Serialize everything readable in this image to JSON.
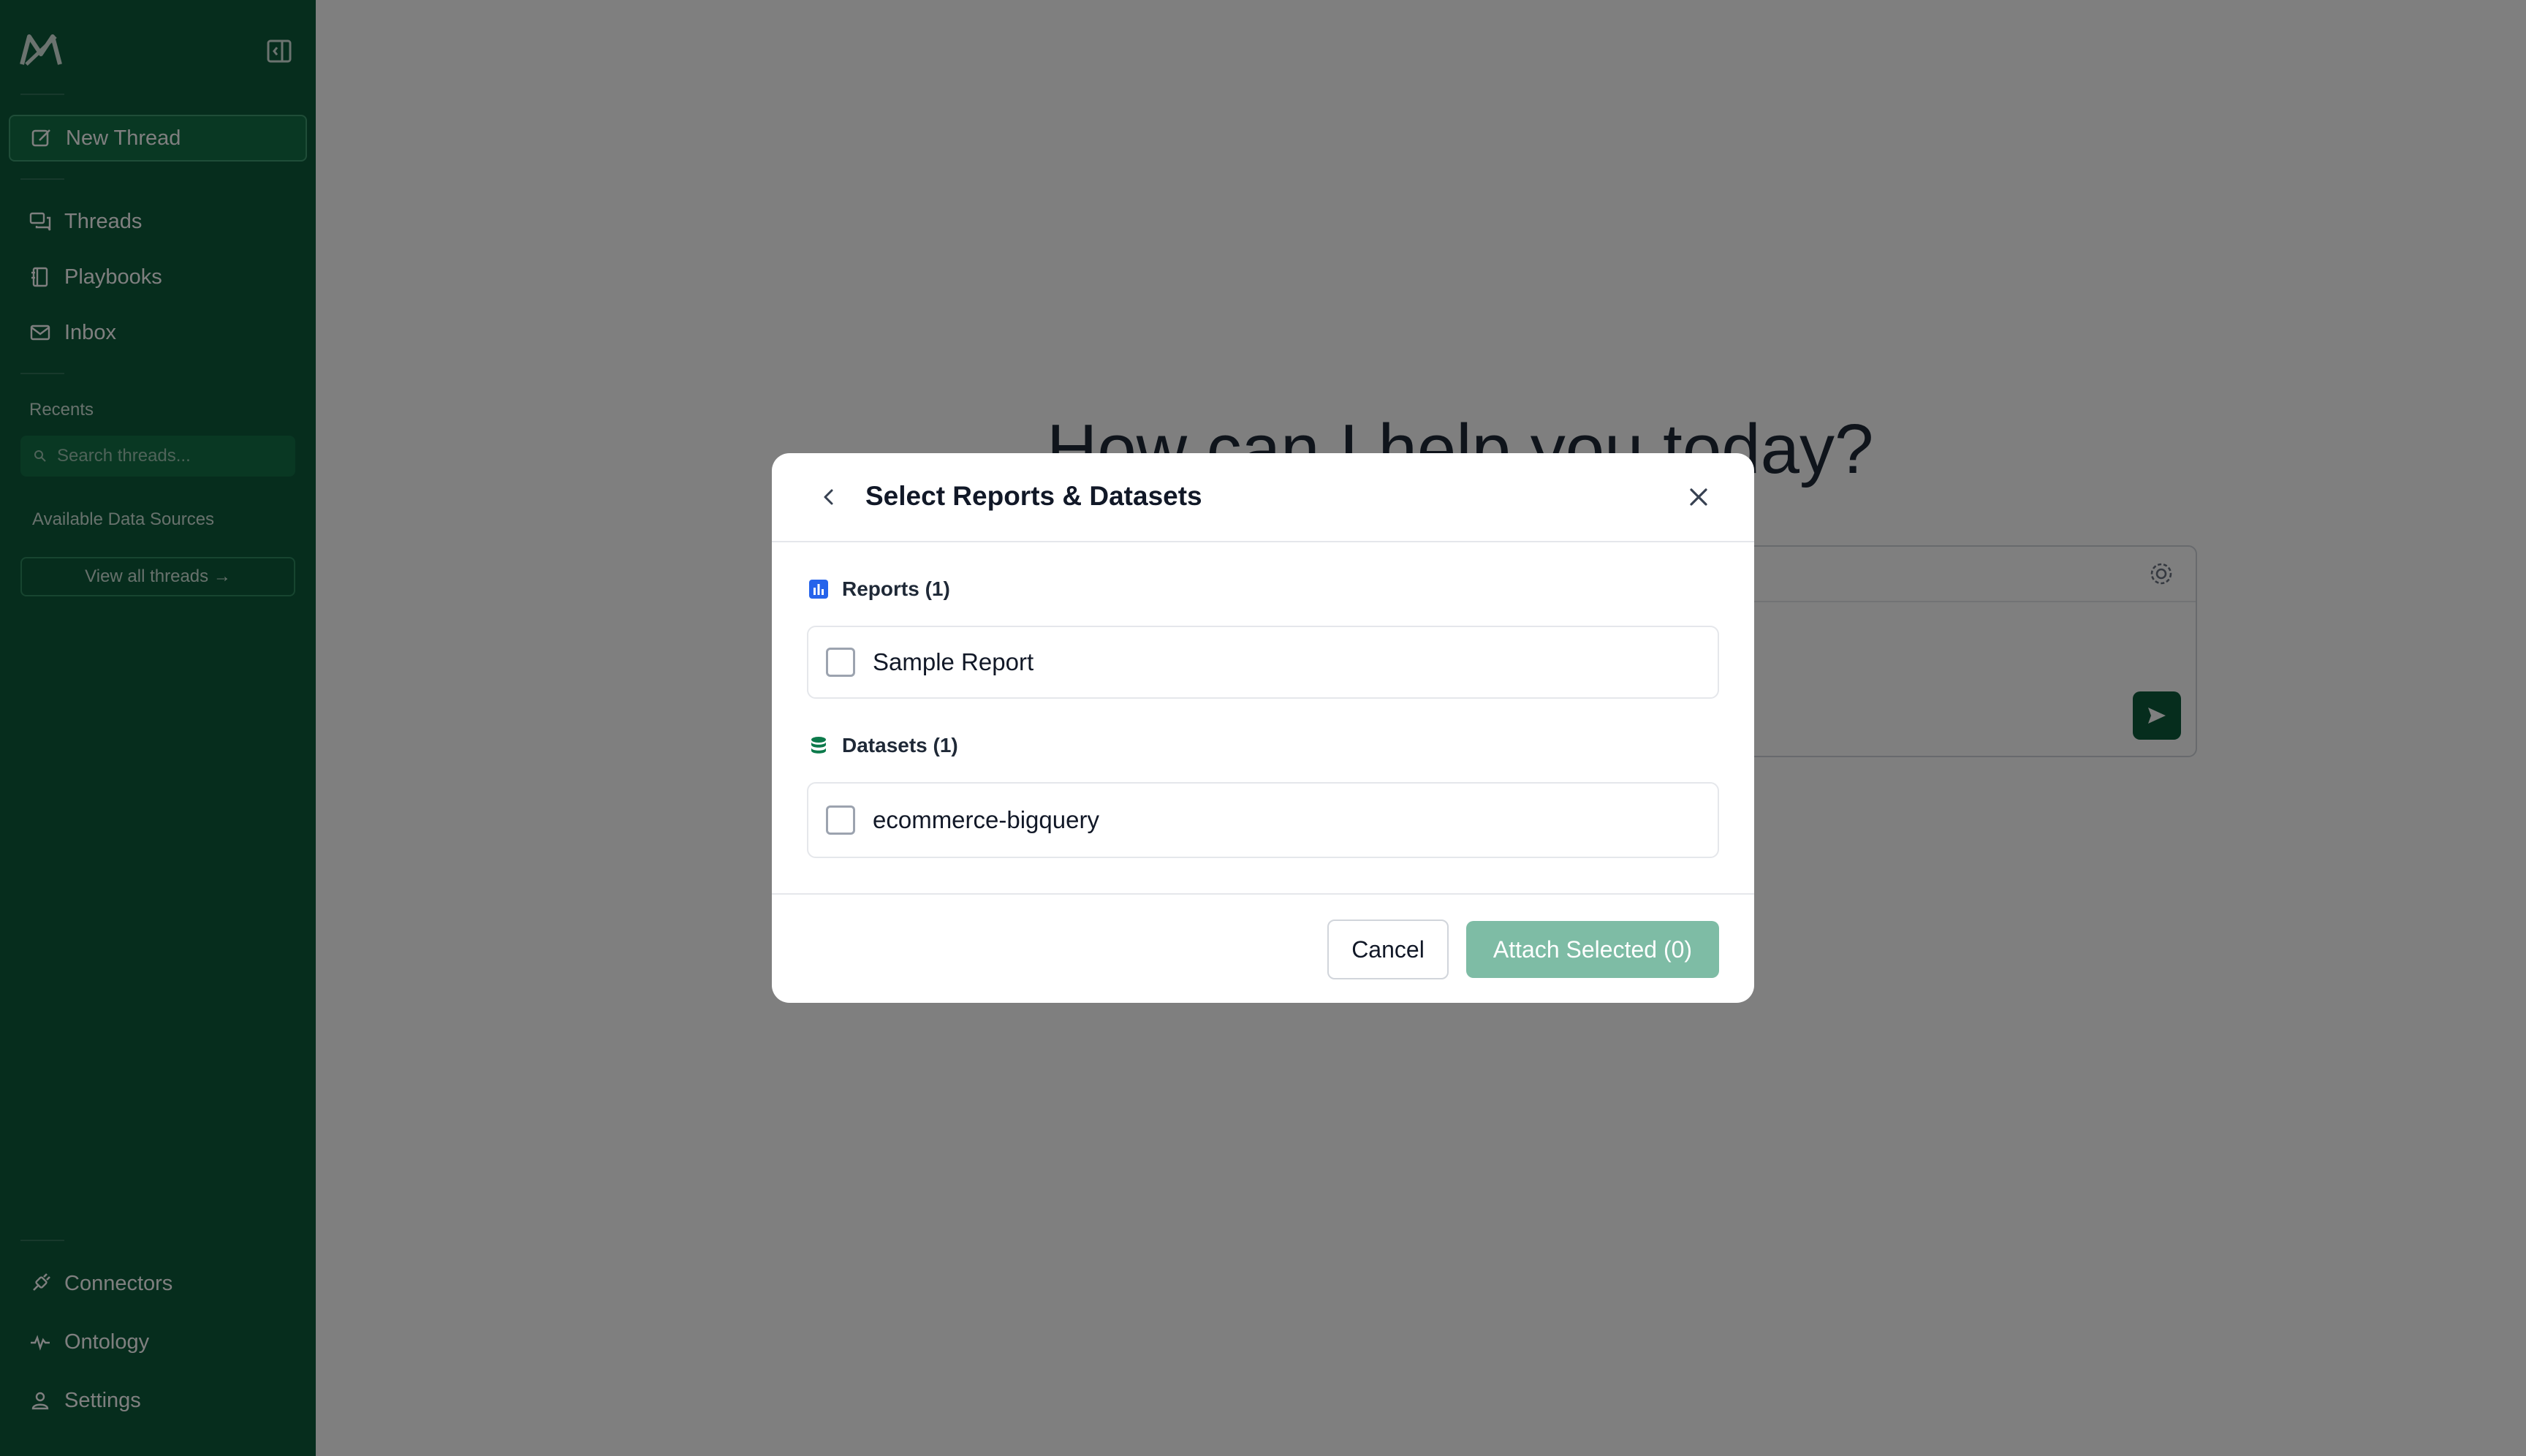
{
  "sidebar": {
    "new_thread_label": "New Thread",
    "nav": [
      {
        "label": "Threads"
      },
      {
        "label": "Playbooks"
      },
      {
        "label": "Inbox"
      }
    ],
    "recents_label": "Recents",
    "search_placeholder": "Search threads...",
    "data_sources_label": "Available Data Sources",
    "view_all_label": "View all threads →",
    "bottom_nav": [
      {
        "label": "Connectors"
      },
      {
        "label": "Ontology"
      },
      {
        "label": "Settings"
      }
    ]
  },
  "main": {
    "heading": "How can I help you today?"
  },
  "modal": {
    "title": "Select Reports & Datasets",
    "reports_label": "Reports (1)",
    "reports": [
      {
        "name": "Sample Report",
        "checked": false
      }
    ],
    "datasets_label": "Datasets (1)",
    "datasets": [
      {
        "name": "ecommerce-bigquery",
        "checked": false
      }
    ],
    "cancel_label": "Cancel",
    "attach_label": "Attach Selected (0)"
  },
  "colors": {
    "sidebar_bg": "#0c5a3b",
    "accent": "#7ebca5",
    "report_icon": "#2563eb",
    "dataset_icon": "#0c7a4b"
  }
}
